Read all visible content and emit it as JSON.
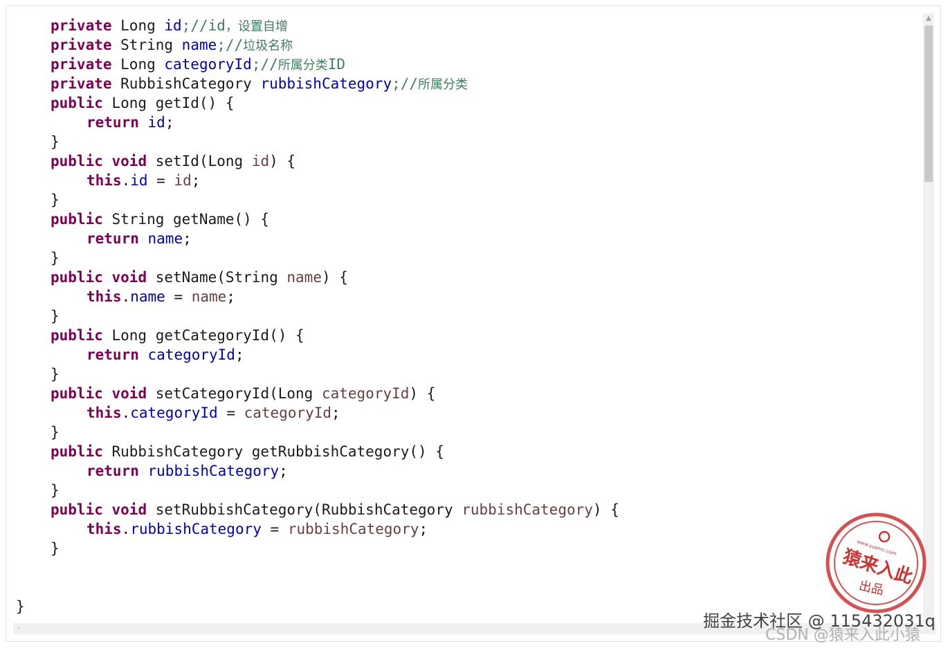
{
  "code": {
    "field_id": {
      "kw": "private",
      "type": " Long ",
      "name": "id",
      "semi": ";//id",
      "cmt": "，设置自增"
    },
    "field_name": {
      "kw": "private",
      "type": " String ",
      "name": "name",
      "semi": ";//",
      "cmt": "垃圾名称"
    },
    "field_category_id": {
      "kw": "private",
      "type": " Long ",
      "name": "categoryId",
      "semi": ";//",
      "cmt": "所属分类",
      "tail": "ID"
    },
    "field_rubbish_category": {
      "kw": "private",
      "type": " RubbishCategory ",
      "name": "rubbishCategory",
      "semi": ";//",
      "cmt": "所属分类"
    },
    "get_id": {
      "kw": "public",
      "sig": " Long getId() {",
      "ret": "return",
      "field": "id"
    },
    "set_id": {
      "kw": "public",
      "void": "void",
      "sig_a": " setId(Long ",
      "param": "id",
      "sig_b": ") {",
      "this": "this",
      "field": "id",
      "eq": " = ",
      "val": "id"
    },
    "get_name": {
      "kw": "public",
      "sig": " String getName() {",
      "ret": "return",
      "field": "name"
    },
    "set_name": {
      "kw": "public",
      "void": "void",
      "sig_a": " setName(String ",
      "param": "name",
      "sig_b": ") {",
      "this": "this",
      "field": "name",
      "eq": " = ",
      "val": "name"
    },
    "get_category_id": {
      "kw": "public",
      "sig": " Long getCategoryId() {",
      "ret": "return",
      "field": "categoryId"
    },
    "set_category_id": {
      "kw": "public",
      "void": "void",
      "sig_a": " setCategoryId(Long ",
      "param": "categoryId",
      "sig_b": ") {",
      "this": "this",
      "field": "categoryId",
      "eq": " = ",
      "val": "categoryId"
    },
    "get_rubbish_category": {
      "kw": "public",
      "sig": " RubbishCategory getRubbishCategory() {",
      "ret": "return",
      "field": "rubbishCategory"
    },
    "set_rubbish_category": {
      "kw": "public",
      "void": "void",
      "sig_a": " setRubbishCategory(RubbishCategory ",
      "param": "rubbishCategory",
      "sig_b": ") {",
      "this": "this",
      "field": "rubbishCategory",
      "eq": " = ",
      "val": "rubbishCategory"
    },
    "close_brace": "}",
    "semicolon": ";"
  },
  "stamp": {
    "url": "www.yuanrc.com",
    "name": "猿来入此",
    "sub": "出品"
  },
  "watermark": {
    "line1": "掘金技术社区 @ 115432031q",
    "line2": "CSDN @猿来入此小猿"
  },
  "colors": {
    "keyword": "#7f0055",
    "field": "#0000c0",
    "param": "#6a3e3e",
    "comment": "#3f7f5f",
    "stamp": "#d03030"
  }
}
